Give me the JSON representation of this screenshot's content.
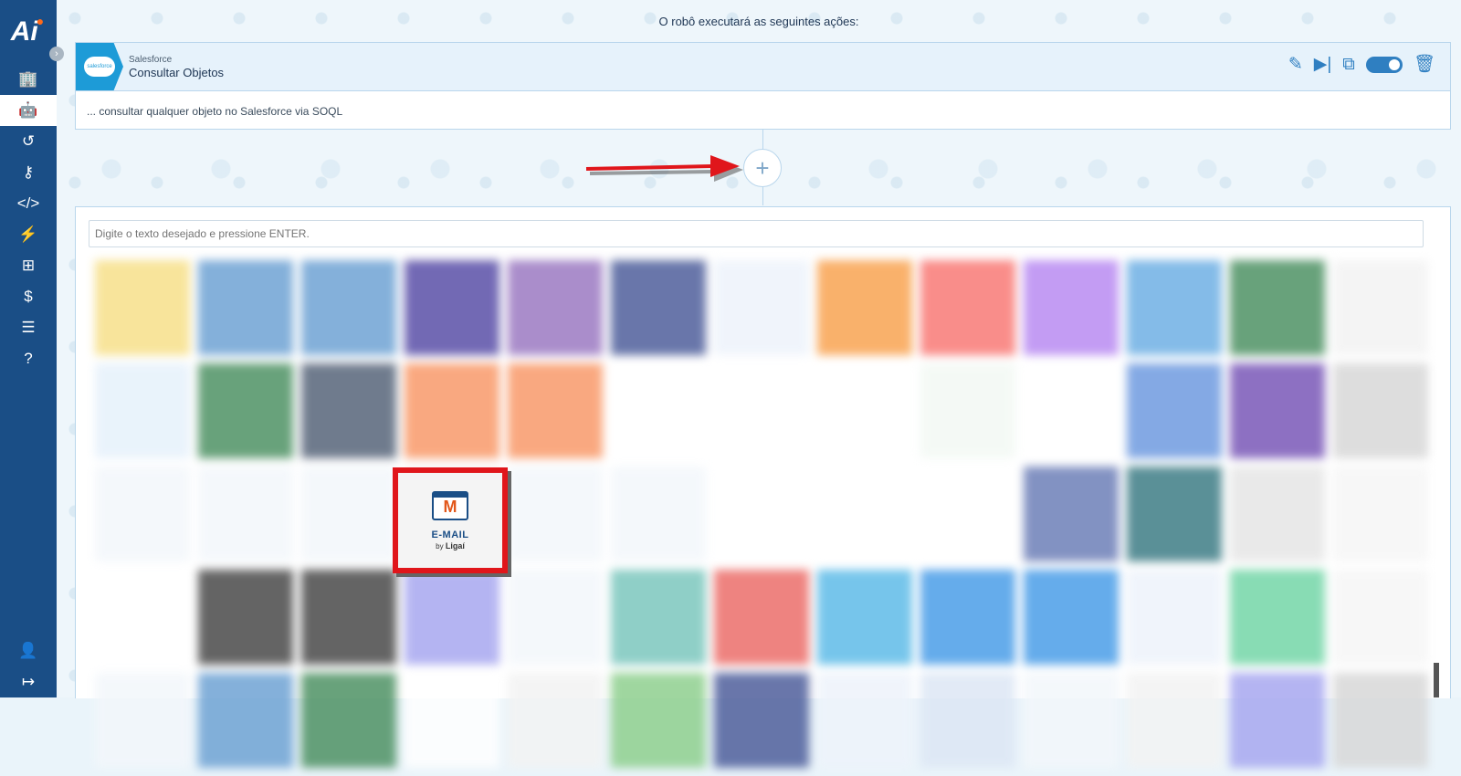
{
  "sidebar": {
    "logo_text": "Ai",
    "items": [
      {
        "icon": "building-icon",
        "glyph": "🏢"
      },
      {
        "icon": "robot-icon",
        "glyph": "🤖"
      },
      {
        "icon": "history-icon",
        "glyph": "↺"
      },
      {
        "icon": "key-icon",
        "glyph": "⚷"
      },
      {
        "icon": "code-icon",
        "glyph": "</>"
      },
      {
        "icon": "bolt-icon",
        "glyph": "⚡"
      },
      {
        "icon": "sitemap-icon",
        "glyph": "⊞"
      },
      {
        "icon": "invoice-icon",
        "glyph": "$"
      },
      {
        "icon": "sliders-icon",
        "glyph": "☰"
      },
      {
        "icon": "help-icon",
        "glyph": "?"
      }
    ],
    "bottom_items": [
      {
        "icon": "user-icon",
        "glyph": "👤"
      },
      {
        "icon": "logout-icon",
        "glyph": "↦"
      }
    ]
  },
  "flow": {
    "title": "O robô executará as seguintes ações:"
  },
  "action_card": {
    "provider": "Salesforce",
    "provider_logo_text": "salesforce",
    "name": "Consultar Objetos",
    "description": "... consultar qualquer objeto no Salesforce via SOQL",
    "tools": [
      "edit-icon",
      "run-step-icon",
      "copy-icon",
      "toggle-switch",
      "trash-icon"
    ],
    "enabled": true
  },
  "add_step": {
    "glyph": "+"
  },
  "selector": {
    "search_placeholder": "Digite o texto desejado e pressione ENTER.",
    "highlighted_tile": {
      "label": "E-MAIL",
      "by_text": "by",
      "brand": "Ligaí",
      "icon": "mail-icon"
    },
    "tile_colors": [
      "#f7e08a",
      "#6fa3d4",
      "#6fa3d4",
      "#5a4fa8",
      "#9c7ac2",
      "#4f5f9c",
      "#eef3fb",
      "#f9a452",
      "#f97a76",
      "#b98bf2",
      "#6fb0e4",
      "#4e9264",
      "#f3f3f3",
      "#e6f1fb",
      "#4e9264",
      "#57657a",
      "#f99a6a",
      "#f99a6a",
      "#ffffff",
      "#ffffff",
      "#ffffff",
      "#f3f9f4",
      "#ffffff",
      "#6f9be0",
      "#7a58b8",
      "#d8d8d8",
      "#f3f7fb",
      "#f3f7fb",
      "#f3f7fb",
      "#f4f4f4",
      "#f3f7fb",
      "#f3f7fb",
      "#ffffff",
      "#ffffff",
      "#ffffff",
      "#6d7fb8",
      "#3e7d86",
      "#e6e6e6",
      "#f6f6f6",
      "#ffffff",
      "#4a4a4a",
      "#4a4a4a",
      "#a8a8f0",
      "#f3f7fb",
      "#7cc7be",
      "#ec6e6a",
      "#5fbce8",
      "#4b9ee8",
      "#4b9ee8",
      "#eef3fb",
      "#74d6a8",
      "#f6f6f6",
      "#f3f7fb",
      "#6fa3d4",
      "#4e9264",
      "#ffffff",
      "#f3f3f3",
      "#8fd08f",
      "#4f5f9c",
      "#eef3fb",
      "#dde7f5",
      "#f3f7fb",
      "#f3f3f3",
      "#a8a8f0",
      "#d8d8d8"
    ]
  }
}
